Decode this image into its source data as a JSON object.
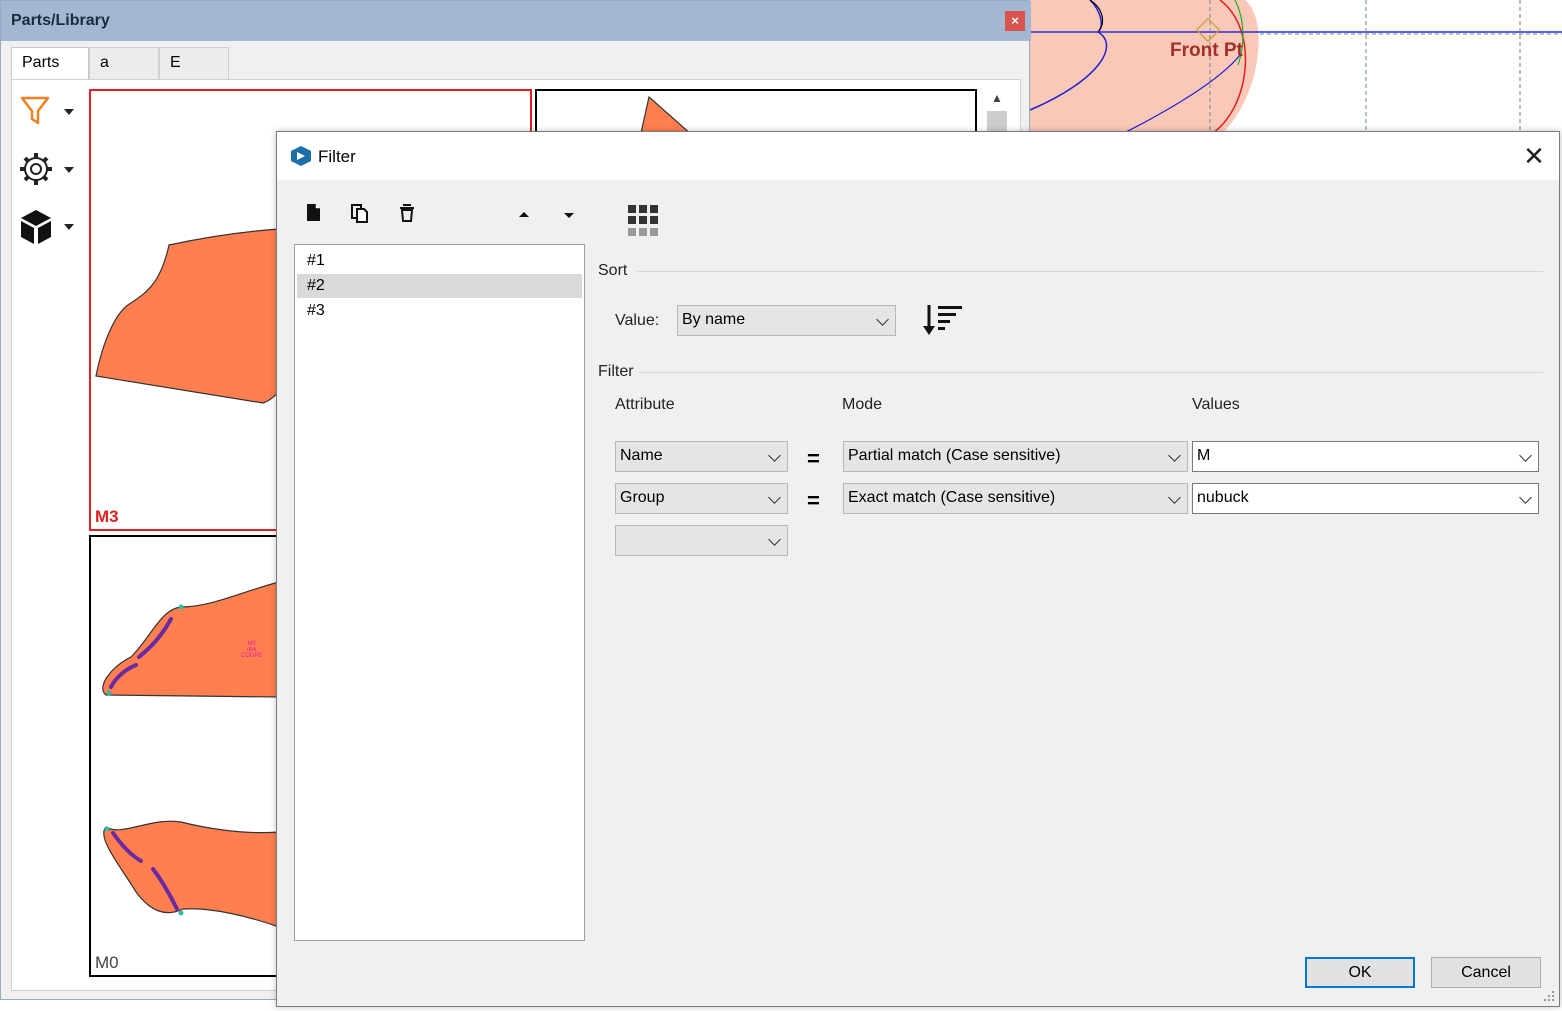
{
  "background": {
    "canvas_label": "Front Pt"
  },
  "parts_panel": {
    "title": "Parts/Library",
    "close_glyph": "×",
    "tabs": [
      {
        "label": "Parts"
      },
      {
        "label": "a"
      },
      {
        "label": "E"
      }
    ],
    "toolbar": [
      "filter-icon",
      "gear-icon",
      "cube-icon"
    ],
    "tiles": [
      {
        "label": "M3",
        "selected": true
      },
      {
        "label": ""
      },
      {
        "label": "M0"
      }
    ],
    "tile_small_text": "M0\nnbk\nCOUPE",
    "colors": {
      "piece_fill": "#ff7f50",
      "selected_border": "#e02020"
    }
  },
  "dialog": {
    "title": "Filter",
    "close_glyph": "✕",
    "toolbar": [
      "new-icon",
      "copy-icon",
      "delete-icon",
      "move-up-icon",
      "move-down-icon",
      "grid-icon"
    ],
    "list": [
      {
        "label": "#1"
      },
      {
        "label": "#2",
        "selected": true
      },
      {
        "label": "#3"
      }
    ],
    "sort": {
      "section_label": "Sort",
      "value_label": "Value:",
      "value": "By name",
      "order_icon": "sort-descending-icon"
    },
    "filter": {
      "section_label": "Filter",
      "headers": {
        "attribute": "Attribute",
        "mode": "Mode",
        "values": "Values"
      },
      "rows": [
        {
          "attribute": "Name",
          "op": "=",
          "mode": "Partial match (Case sensitive)",
          "value": "M"
        },
        {
          "attribute": "Group",
          "op": "=",
          "mode": "Exact match (Case sensitive)",
          "value": "nubuck"
        },
        {
          "attribute": ""
        }
      ]
    },
    "buttons": {
      "ok": "OK",
      "cancel": "Cancel"
    },
    "colors": {
      "accent": "#0078d7"
    }
  }
}
